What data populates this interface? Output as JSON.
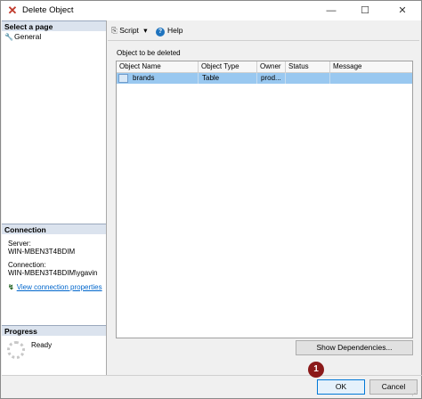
{
  "window": {
    "title": "Delete Object",
    "app_icon": "red-x-icon",
    "minimize_glyph": "—",
    "maximize_glyph": "☐",
    "close_glyph": "✕"
  },
  "left_pane": {
    "select_page_header": "Select a page",
    "pages": [
      {
        "label": "General",
        "icon": "wrench-icon"
      }
    ],
    "connection_header": "Connection",
    "server_label": "Server:",
    "server_value": "WIN-MBEN3T4BDIM",
    "connection_label": "Connection:",
    "connection_value": "WIN-MBEN3T4BDIM\\ygavin",
    "view_connection_link": "View connection properties",
    "progress_header": "Progress",
    "progress_status": "Ready"
  },
  "toolbar": {
    "script_label": "Script",
    "help_label": "Help"
  },
  "main": {
    "group_label": "Object to be deleted",
    "columns": [
      "Object Name",
      "Object Type",
      "Owner",
      "Status",
      "Message"
    ],
    "rows": [
      {
        "object_name": "brands",
        "object_type": "Table",
        "owner": "prod...",
        "status": "",
        "message": ""
      }
    ],
    "show_dependencies_label": "Show Dependencies..."
  },
  "footer": {
    "ok_label": "OK",
    "cancel_label": "Cancel",
    "step_badge": "1"
  },
  "colors": {
    "selected_row": "#99c8f0",
    "section_header": "#dbe3ee",
    "link": "#0066cc",
    "badge": "#8b1a1a",
    "ok_border": "#0078d7"
  }
}
